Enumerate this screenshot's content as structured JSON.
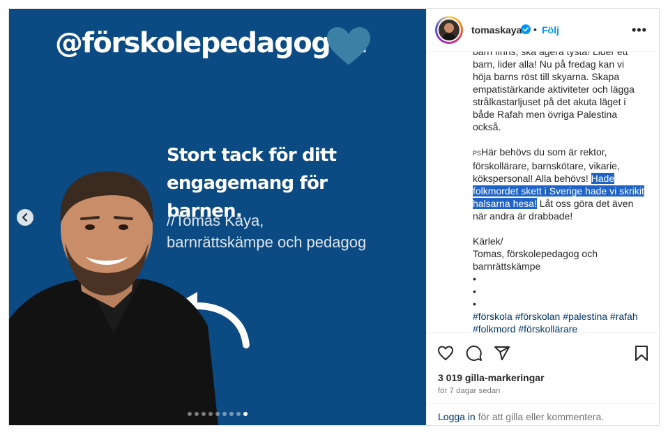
{
  "post_image": {
    "handle": "@förskolepedagogen",
    "thanks_line1": "Stort tack för ditt",
    "thanks_line2": "engagemang för barnen.",
    "signature_line1": "//Tomas Kaya,",
    "signature_line2": "barnrättskämpe och pedagog",
    "carousel": {
      "total": 9,
      "active": 9
    },
    "colors": {
      "background": "#0b4a82",
      "heart": "#3d80a6"
    }
  },
  "header": {
    "username": "tomaskaya",
    "separator": "•",
    "follow_label": "Följ",
    "more_label": "•••"
  },
  "caption": {
    "line_a": "barn finns, ska agera tysta! Lider ett",
    "line_b": "barn, lider alla! Nu på fredag kan vi",
    "line_c": "höja barns röst till skyarna. Skapa",
    "line_d": "empatistärkande aktiviteter och lägga",
    "line_e": "strålkastarljuset på det akuta läget i",
    "line_f": "både Rafah men övriga Palestina",
    "line_g": "också.",
    "ps_prefix": "PS",
    "ps_text": "Här behövs du som är rektor, förskollärare, barnskötare, vikarie, kökspersonal! Alla behövs! ",
    "ps_highlight": "Hade folkmordet skett i Sverige hade vi skrikit halsarna hesa!",
    "ps_after": " Låt oss göra det även när andra är drabbade!",
    "love": "Kärlek/",
    "sign_name": "Tomas, förskolepedagog och",
    "sign_role": "barnrättskämpe",
    "bullet": "•",
    "hashtags": [
      "#förskola",
      "#förskolan",
      "#palestina",
      "#rafah",
      "#folkmord",
      "#förskollärare"
    ]
  },
  "actions": {
    "likes": "3 019 gilla-markeringar",
    "time": "för 7 dagar sedan"
  },
  "login": {
    "link": "Logga in",
    "rest": " för att gilla eller kommentera."
  },
  "icons": [
    "heart-icon",
    "comment-icon",
    "share-icon",
    "bookmark-icon",
    "verified-icon",
    "chevron-left-icon"
  ],
  "colors": {
    "accent": "#0095f6",
    "highlight": "#1f63c7",
    "link": "#00376b"
  }
}
